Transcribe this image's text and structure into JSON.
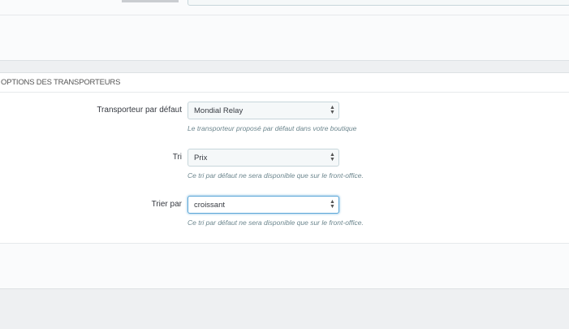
{
  "section": {
    "title": "OPTIONS DES TRANSPORTEURS"
  },
  "fields": [
    {
      "label": "Transporteur par défaut",
      "value": "Mondial Relay",
      "help": "Le transporteur proposé par défaut dans votre boutique"
    },
    {
      "label": "Tri",
      "value": "Prix",
      "help": "Ce tri par défaut ne sera disponible que sur le front-office."
    },
    {
      "label": "Trier par",
      "value": "croissant",
      "help": "Ce tri par défaut ne sera disponible que sur le front-office."
    }
  ],
  "icons": {
    "select_caret": "updown-caret-icon"
  },
  "colors": {
    "focus": "#5ca7d8",
    "help_text": "#6c868e",
    "page_bg": "#eef0f2"
  }
}
